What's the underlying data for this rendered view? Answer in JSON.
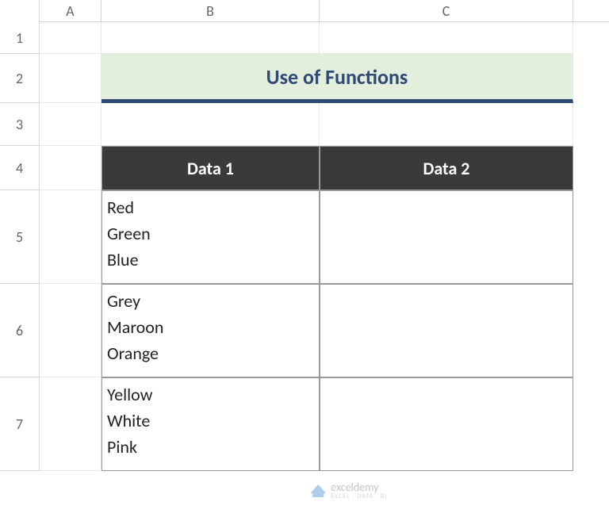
{
  "columns": {
    "a": "A",
    "b": "B",
    "c": "C"
  },
  "rows": {
    "r1": "1",
    "r2": "2",
    "r3": "3",
    "r4": "4",
    "r5": "5",
    "r6": "6",
    "r7": "7"
  },
  "title": "Use of Functions",
  "headers": {
    "data1": "Data 1",
    "data2": "Data 2"
  },
  "cells": {
    "b5_line1": "Red",
    "b5_line2": "Green",
    "b5_line3": "Blue",
    "b6_line1": "Grey",
    "b6_line2": "Maroon",
    "b6_line3": "Orange",
    "b7_line1": "Yellow",
    "b7_line2": "White",
    "b7_line3": "Pink"
  },
  "watermark": {
    "name": "exceldemy",
    "tagline": "EXCEL · DATA · BI"
  }
}
